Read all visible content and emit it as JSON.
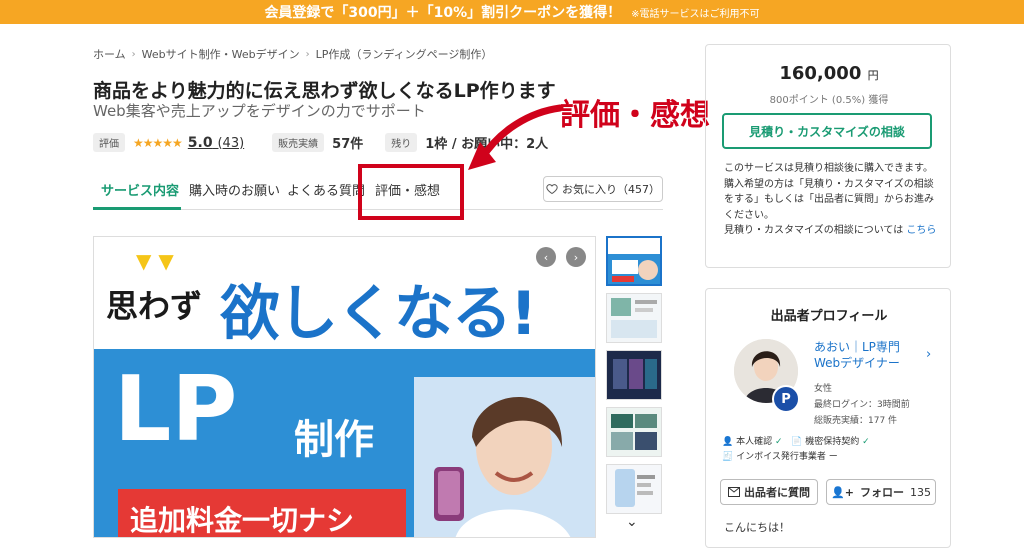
{
  "banner": {
    "main": "会員登録で「300円」＋「10%」割引クーポンを獲得！",
    "sub": "※電話サービスはご利用不可"
  },
  "breadcrumb": [
    "ホーム",
    "Webサイト制作・Webデザイン",
    "LP作成（ランディングページ制作）"
  ],
  "service": {
    "title": "商品をより魅力的に伝え思わず欲しくなるLP作ります",
    "subtitle": "Web集客や売上アップをデザインの力でサポート",
    "rating_label": "評価",
    "stars": "★★★★★",
    "rating_value": "5.0",
    "rating_count": "(43)",
    "sales_label": "販売実績",
    "sales_value": "57件",
    "remaining_label": "残り",
    "remaining_value": "1枠 / お願い中：2人"
  },
  "tabs": [
    {
      "label": "サービス内容"
    },
    {
      "label": "購入時のお願い"
    },
    {
      "label": "よくある質問"
    },
    {
      "label": "評価・感想"
    }
  ],
  "favorite": {
    "label": "お気に入り（457）"
  },
  "annotation": {
    "text": "評価・感想"
  },
  "main_image": {
    "omowazu": "思わず",
    "hoshiku": "欲しくなる!",
    "lp": "LP",
    "seisaku": "制作",
    "banner": "追加料金一切ナシ"
  },
  "thumbnails": [
    "thumb-1",
    "thumb-2",
    "thumb-3",
    "thumb-4",
    "thumb-5"
  ],
  "price_box": {
    "price": "160,000",
    "currency": "円",
    "points": "800ポイント (0.5%) 獲得",
    "quote_button": "見積り・カスタマイズの相談",
    "note": "このサービスは見積り相談後に購入できます。購入希望の方は「見積り・カスタマイズの相談をする」もしくは「出品者に質問」からお進みください。",
    "note2": "見積り・カスタマイズの相談については",
    "note_link": "こちら"
  },
  "profile": {
    "title": "出品者プロフィール",
    "name": "あおい｜LP専門Webデザイナー",
    "gender": "女性",
    "last_login": "最終ログイン：3時間前",
    "total_sales": "総販売実績：177 件",
    "badge": "P",
    "verify1": "本人確認",
    "verify2": "機密保持契約",
    "verify3": "インボイス発行事業者",
    "verify3_status": "ー",
    "question_button": "出品者に質問",
    "follow_button": "フォロー",
    "follow_count": "135",
    "greeting": "こんにちは！"
  },
  "colors": {
    "accent": "#1a9b73",
    "banner": "#f6a623",
    "annotation": "#d0021b",
    "link": "#1b73c9"
  }
}
